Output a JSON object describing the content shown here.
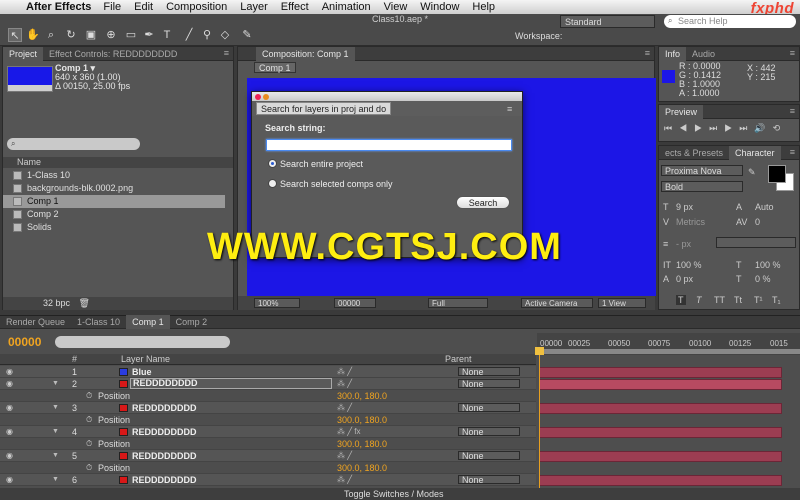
{
  "menubar": {
    "app_name": "After Effects",
    "items": [
      "File",
      "Edit",
      "Composition",
      "Layer",
      "Effect",
      "Animation",
      "View",
      "Window",
      "Help"
    ],
    "brand": "fxphd"
  },
  "toolbar": {
    "document_title": "Class10.aep *",
    "workspace_label": "Workspace:",
    "workspace_value": "Standard",
    "search_help_placeholder": "Search Help"
  },
  "project_panel": {
    "tabs": [
      "Project",
      "Effect Controls: REDDDDDDDD"
    ],
    "comp_name": "Comp 1 ▾",
    "comp_size": "640 x 360 (1.00)",
    "comp_duration": "Δ 00150, 25.00 fps",
    "column_name": "Name",
    "items": [
      {
        "label": "1-Class 10",
        "type": "folder"
      },
      {
        "label": "backgrounds-blk.0002.png",
        "type": "footage"
      },
      {
        "label": "Comp 1",
        "type": "comp",
        "selected": true
      },
      {
        "label": "Comp 2",
        "type": "comp"
      },
      {
        "label": "Solids",
        "type": "folder"
      }
    ],
    "bpc": "32 bpc"
  },
  "comp_viewer": {
    "tab": "Composition: Comp 1",
    "subtab": "Comp 1",
    "zoom": "100%",
    "timecode": "00000",
    "resolution": "Full",
    "camera": "Active Camera",
    "view": "1 View",
    "canvas_color": "#1c16e6"
  },
  "search_dialog": {
    "tab": "Search for layers in proj and do",
    "label": "Search string:",
    "input_value": "",
    "option_all": "Search entire project",
    "option_selected": "Search selected comps only",
    "search_button": "Search"
  },
  "watermark": "WWW.CGTSJ.COM",
  "info_panel": {
    "tabs": [
      "Info",
      "Audio"
    ],
    "r": "R : 0.0000",
    "g": "G : 0.1412",
    "b": "B : 1.0000",
    "a": "A : 1.0000",
    "x": "X : 442",
    "y": "Y : 215"
  },
  "preview_panel": {
    "tab": "Preview"
  },
  "character_panel": {
    "tabs": [
      "ects & Presets",
      "Character"
    ],
    "font": "Proxima Nova",
    "style": "Bold",
    "size": "9 px",
    "leading": "Auto",
    "kerning": "Metrics",
    "tracking": "0",
    "stroke_width": "- px",
    "vert_scale": "100 %",
    "horiz_scale": "100 %",
    "baseline": "0 px",
    "tsume": "0 %",
    "format_buttons": [
      "T",
      "T",
      "TT",
      "Tt",
      "T¹",
      "T₁"
    ]
  },
  "timeline": {
    "tabs": [
      "Render Queue",
      "1-Class 10",
      "Comp 1",
      "Comp 2"
    ],
    "active_tab": "Comp 1",
    "timecode": "00000",
    "column_layer_name": "Layer Name",
    "column_parent": "Parent",
    "ruler_ticks": [
      "00000",
      "00025",
      "00050",
      "00075",
      "00100",
      "00125",
      "0015"
    ],
    "rows": [
      {
        "kind": "layer",
        "num": "1",
        "name": "Blue",
        "color": "#2a3ce0",
        "parent": "None"
      },
      {
        "kind": "layer",
        "num": "2",
        "name": "REDDDDDDDD",
        "color": "#d81818",
        "parent": "None",
        "editing": true
      },
      {
        "kind": "prop",
        "label": "Position",
        "value": "300.0, 180.0"
      },
      {
        "kind": "layer",
        "num": "3",
        "name": "REDDDDDDDD",
        "color": "#d81818",
        "parent": "None"
      },
      {
        "kind": "prop",
        "label": "Position",
        "value": "300.0, 180.0"
      },
      {
        "kind": "layer",
        "num": "4",
        "name": "REDDDDDDDD",
        "color": "#d81818",
        "parent": "None"
      },
      {
        "kind": "prop",
        "label": "Position",
        "value": "300.0, 180.0"
      },
      {
        "kind": "layer",
        "num": "5",
        "name": "REDDDDDDDD",
        "color": "#d81818",
        "parent": "None"
      },
      {
        "kind": "prop",
        "label": "Position",
        "value": "300.0, 180.0"
      },
      {
        "kind": "layer",
        "num": "6",
        "name": "REDDDDDDDD",
        "color": "#d81818",
        "parent": "None"
      }
    ],
    "toggle_label": "Toggle Switches / Modes"
  }
}
